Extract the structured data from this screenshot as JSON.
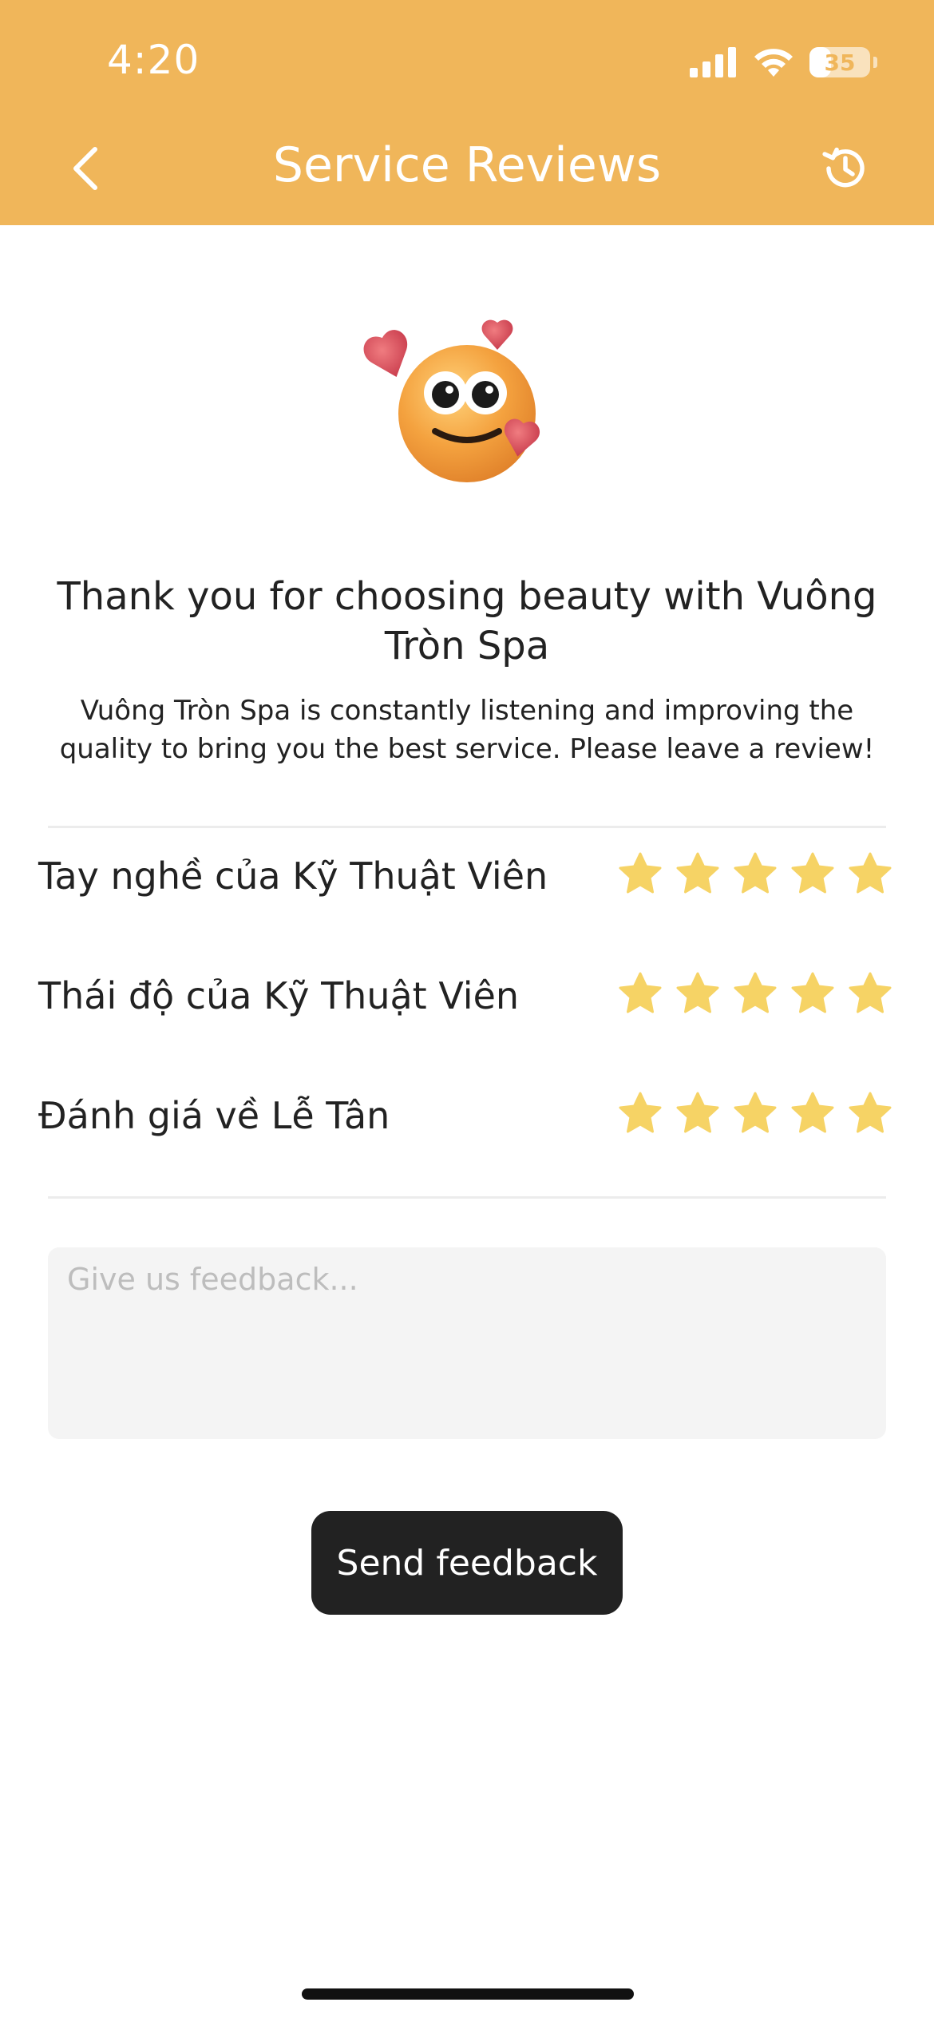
{
  "status_bar": {
    "time": "4:20",
    "battery_level": "35",
    "battery_fraction": 0.35,
    "icons": [
      "signal-icon",
      "wifi-icon",
      "battery-icon"
    ]
  },
  "header": {
    "title": "Service Reviews",
    "back_icon": "chevron-left-icon",
    "history_icon": "history-icon",
    "background_color": "#F0B65A"
  },
  "hero": {
    "emoji": "smiling-face-with-hearts-icon"
  },
  "thanks": {
    "title": "Thank you  for choosing beauty with Vuông Tròn Spa",
    "subtitle": "Vuông Tròn Spa is constantly listening and improving the quality to bring you the best service. Please leave a review!"
  },
  "ratings": [
    {
      "label": "Tay nghề của Kỹ Thuật Viên",
      "stars": 5,
      "max": 5
    },
    {
      "label": "Thái độ của Kỹ Thuật Viên",
      "stars": 5,
      "max": 5
    },
    {
      "label": "Đánh giá về Lễ Tân",
      "stars": 5,
      "max": 5
    }
  ],
  "star_color": "#F6D365",
  "feedback": {
    "placeholder": "Give us feedback...",
    "value": ""
  },
  "send_button": {
    "label": "Send feedback"
  }
}
